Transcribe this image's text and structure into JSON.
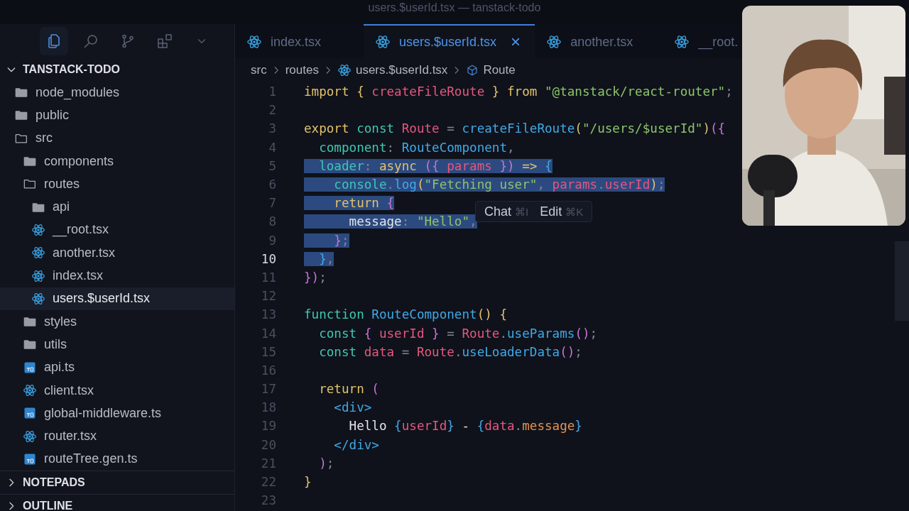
{
  "window": {
    "title": "users.$userId.tsx — tanstack-todo"
  },
  "activity_bar": [
    {
      "kind": "files",
      "selected": true
    },
    {
      "kind": "search",
      "selected": false
    },
    {
      "kind": "branch",
      "selected": false
    },
    {
      "kind": "extensions",
      "selected": false
    },
    {
      "kind": "more",
      "selected": false
    }
  ],
  "explorer": {
    "title": "TANSTACK-TODO",
    "expanded": true,
    "items": [
      {
        "label": "node_modules",
        "kind": "folder",
        "expanded": false,
        "selected": false
      },
      {
        "label": "public",
        "kind": "folder",
        "expanded": false,
        "selected": false
      },
      {
        "label": "src",
        "kind": "folder",
        "expanded": true,
        "selected": false,
        "children": [
          {
            "label": "components",
            "kind": "folder",
            "expanded": false,
            "selected": false
          },
          {
            "label": "routes",
            "kind": "folder",
            "expanded": true,
            "selected": false,
            "children": [
              {
                "label": "api",
                "kind": "folder",
                "expanded": false,
                "selected": false
              },
              {
                "label": "__root.tsx",
                "kind": "react",
                "selected": false
              },
              {
                "label": "another.tsx",
                "kind": "react",
                "selected": false
              },
              {
                "label": "index.tsx",
                "kind": "react",
                "selected": false
              },
              {
                "label": "users.$userId.tsx",
                "kind": "react",
                "selected": true
              }
            ]
          },
          {
            "label": "styles",
            "kind": "folder",
            "expanded": false,
            "selected": false
          },
          {
            "label": "utils",
            "kind": "folder",
            "expanded": false,
            "selected": false
          },
          {
            "label": "api.ts",
            "kind": "ts",
            "selected": false
          },
          {
            "label": "client.tsx",
            "kind": "react",
            "selected": false
          },
          {
            "label": "global-middleware.ts",
            "kind": "ts",
            "selected": false
          },
          {
            "label": "router.tsx",
            "kind": "react",
            "selected": false
          },
          {
            "label": "routeTree.gen.ts",
            "kind": "ts",
            "selected": false
          }
        ]
      }
    ]
  },
  "sections": [
    {
      "title": "NOTEPADS",
      "expanded": false
    },
    {
      "title": "OUTLINE",
      "expanded": false
    }
  ],
  "tabs": [
    {
      "label": "index.tsx",
      "selected": false
    },
    {
      "label": "users.$userId.tsx",
      "selected": true,
      "close": "×"
    },
    {
      "label": "another.tsx",
      "selected": false
    },
    {
      "label": "__root.",
      "selected": false
    }
  ],
  "breadcrumb": [
    {
      "label": "src",
      "kind": "folder"
    },
    {
      "label": "routes",
      "kind": "folder"
    },
    {
      "label": "users.$userId.tsx",
      "kind": "react"
    },
    {
      "label": "Route",
      "kind": "symbol"
    }
  ],
  "code": [
    {
      "number": "1",
      "selected": false,
      "current": false,
      "tokens": [
        {
          "text": "import ",
          "kind": "kw"
        },
        {
          "text": "{ ",
          "kind": "brace"
        },
        {
          "text": "createFileRoute ",
          "kind": "var"
        },
        {
          "text": "} ",
          "kind": "brace"
        },
        {
          "text": "from ",
          "kind": "kw"
        },
        {
          "text": "\"@tanstack/react-router\"",
          "kind": "str"
        },
        {
          "text": ";",
          "kind": "punct"
        }
      ]
    },
    {
      "number": "2",
      "selected": false,
      "current": false
    },
    {
      "number": "3",
      "selected": false,
      "current": false,
      "tokens": [
        {
          "text": "export ",
          "kind": "kw"
        },
        {
          "text": "const ",
          "kind": "decl"
        },
        {
          "text": "Route ",
          "kind": "var"
        },
        {
          "text": "= ",
          "kind": "punct"
        },
        {
          "text": "createFileRoute",
          "kind": "fn"
        },
        {
          "text": "(",
          "kind": "kw"
        },
        {
          "text": "\"/users/$userId\"",
          "kind": "str"
        },
        {
          "text": ")",
          "kind": "kw"
        },
        {
          "text": "({",
          "kind": "bracket"
        }
      ]
    },
    {
      "number": "4",
      "selected": false,
      "current": false,
      "tokens": [
        {
          "text": "  component",
          "kind": "decl"
        },
        {
          "text": ": ",
          "kind": "punct"
        },
        {
          "text": "RouteComponent",
          "kind": "fn"
        },
        {
          "text": ",",
          "kind": "punct"
        }
      ]
    },
    {
      "number": "5",
      "selected": true,
      "current": false,
      "tokens": [
        {
          "text": "  loader",
          "kind": "decl"
        },
        {
          "text": ": ",
          "kind": "punct"
        },
        {
          "text": "async ",
          "kind": "kw"
        },
        {
          "text": "({ ",
          "kind": "bracket"
        },
        {
          "text": "params ",
          "kind": "var"
        },
        {
          "text": "}) ",
          "kind": "bracket"
        },
        {
          "text": "=> ",
          "kind": "kw"
        },
        {
          "text": "{",
          "kind": "fn"
        }
      ]
    },
    {
      "number": "6",
      "selected": true,
      "current": false,
      "tokens": [
        {
          "text": "    console",
          "kind": "decl"
        },
        {
          "text": ".",
          "kind": "punct"
        },
        {
          "text": "log",
          "kind": "fn"
        },
        {
          "text": "(",
          "kind": "kw"
        },
        {
          "text": "\"Fetching user\"",
          "kind": "str"
        },
        {
          "text": ", ",
          "kind": "punct"
        },
        {
          "text": "params",
          "kind": "var"
        },
        {
          "text": ".",
          "kind": "punct"
        },
        {
          "text": "userId",
          "kind": "var"
        },
        {
          "text": ")",
          "kind": "kw"
        },
        {
          "text": ";",
          "kind": "punct"
        }
      ]
    },
    {
      "number": "7",
      "selected": true,
      "current": false,
      "tokens": [
        {
          "text": "    return ",
          "kind": "kw"
        },
        {
          "text": "{",
          "kind": "bracket"
        }
      ]
    },
    {
      "number": "8",
      "selected": true,
      "current": false,
      "tokens": [
        {
          "text": "      message",
          "kind": "plain"
        },
        {
          "text": ": ",
          "kind": "punct"
        },
        {
          "text": "\"Hello\"",
          "kind": "str"
        },
        {
          "text": ",",
          "kind": "punct"
        }
      ]
    },
    {
      "number": "9",
      "selected": true,
      "current": false,
      "tokens": [
        {
          "text": "    }",
          "kind": "bracket"
        },
        {
          "text": ";",
          "kind": "punct"
        }
      ]
    },
    {
      "number": "10",
      "selected": true,
      "current": true,
      "tokens": [
        {
          "text": "  }",
          "kind": "fn"
        },
        {
          "text": ",",
          "kind": "punct"
        }
      ]
    },
    {
      "number": "11",
      "selected": false,
      "current": false,
      "tokens": [
        {
          "text": "})",
          "kind": "bracket"
        },
        {
          "text": ";",
          "kind": "punct"
        }
      ]
    },
    {
      "number": "12",
      "selected": false,
      "current": false
    },
    {
      "number": "13",
      "selected": false,
      "current": false,
      "tokens": [
        {
          "text": "function ",
          "kind": "decl"
        },
        {
          "text": "RouteComponent",
          "kind": "fn"
        },
        {
          "text": "() {",
          "kind": "kw"
        }
      ]
    },
    {
      "number": "14",
      "selected": false,
      "current": false,
      "tokens": [
        {
          "text": "  const ",
          "kind": "decl"
        },
        {
          "text": "{ ",
          "kind": "bracket"
        },
        {
          "text": "userId ",
          "kind": "var"
        },
        {
          "text": "} ",
          "kind": "bracket"
        },
        {
          "text": "= ",
          "kind": "punct"
        },
        {
          "text": "Route",
          "kind": "var"
        },
        {
          "text": ".",
          "kind": "punct"
        },
        {
          "text": "useParams",
          "kind": "fn"
        },
        {
          "text": "()",
          "kind": "bracket"
        },
        {
          "text": ";",
          "kind": "punct"
        }
      ]
    },
    {
      "number": "15",
      "selected": false,
      "current": false,
      "tokens": [
        {
          "text": "  const ",
          "kind": "decl"
        },
        {
          "text": "data ",
          "kind": "var"
        },
        {
          "text": "= ",
          "kind": "punct"
        },
        {
          "text": "Route",
          "kind": "var"
        },
        {
          "text": ".",
          "kind": "punct"
        },
        {
          "text": "useLoaderData",
          "kind": "fn"
        },
        {
          "text": "()",
          "kind": "bracket"
        },
        {
          "text": ";",
          "kind": "punct"
        }
      ]
    },
    {
      "number": "16",
      "selected": false,
      "current": false
    },
    {
      "number": "17",
      "selected": false,
      "current": false,
      "tokens": [
        {
          "text": "  return ",
          "kind": "kw"
        },
        {
          "text": "(",
          "kind": "bracket"
        }
      ]
    },
    {
      "number": "18",
      "selected": false,
      "current": false,
      "tokens": [
        {
          "text": "    <div>",
          "kind": "fn"
        }
      ]
    },
    {
      "number": "19",
      "selected": false,
      "current": false,
      "tokens": [
        {
          "text": "      Hello ",
          "kind": "plain"
        },
        {
          "text": "{",
          "kind": "fn"
        },
        {
          "text": "userId",
          "kind": "var"
        },
        {
          "text": "}",
          "kind": "fn"
        },
        {
          "text": " - ",
          "kind": "plain"
        },
        {
          "text": "{",
          "kind": "fn"
        },
        {
          "text": "data",
          "kind": "var"
        },
        {
          "text": ".",
          "kind": "punct"
        },
        {
          "text": "message",
          "kind": "prop"
        },
        {
          "text": "}",
          "kind": "fn"
        }
      ]
    },
    {
      "number": "20",
      "selected": false,
      "current": false,
      "tokens": [
        {
          "text": "    </div>",
          "kind": "fn"
        }
      ]
    },
    {
      "number": "21",
      "selected": false,
      "current": false,
      "tokens": [
        {
          "text": "  )",
          "kind": "bracket"
        },
        {
          "text": ";",
          "kind": "punct"
        }
      ]
    },
    {
      "number": "22",
      "selected": false,
      "current": false,
      "tokens": [
        {
          "text": "}",
          "kind": "kw"
        }
      ]
    },
    {
      "number": "23",
      "selected": false,
      "current": false
    }
  ],
  "inline_menu": [
    {
      "label": "Chat",
      "shortcut": "⌘I"
    },
    {
      "label": "Edit",
      "shortcut": "⌘K"
    }
  ]
}
